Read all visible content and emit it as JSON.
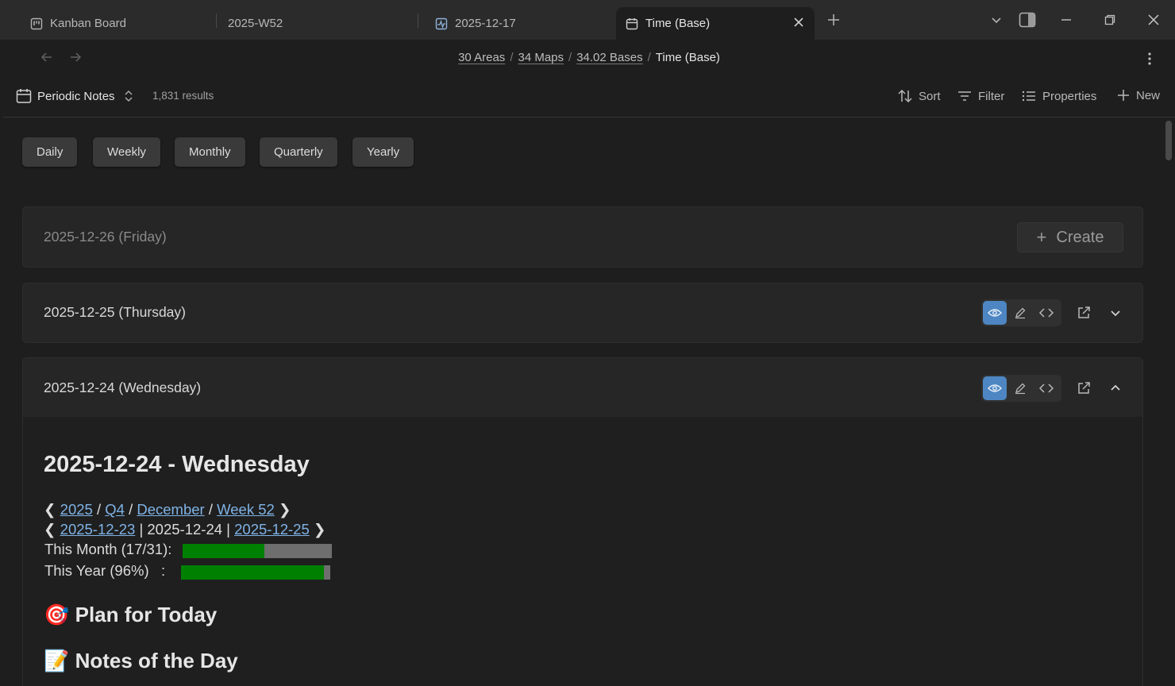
{
  "tabs": [
    {
      "label": "Kanban Board",
      "icon": "kanban-icon"
    },
    {
      "label": "2025-W52",
      "icon": ""
    },
    {
      "label": "2025-12-17",
      "icon": "activity-icon"
    },
    {
      "label": "Time (Base)",
      "icon": "calendar-icon",
      "active": true
    }
  ],
  "breadcrumb": {
    "items": [
      "30 Areas",
      "34 Maps",
      "34.02 Bases"
    ],
    "current": "Time (Base)",
    "separator": "/"
  },
  "base": {
    "view_name": "Periodic Notes",
    "results": "1,831 results",
    "sort": "Sort",
    "filter": "Filter",
    "properties": "Properties",
    "new": "New"
  },
  "filters": [
    "Daily",
    "Weekly",
    "Monthly",
    "Quarterly",
    "Yearly"
  ],
  "cards": [
    {
      "title": "2025-12-26 (Friday)",
      "create_label": "Create"
    },
    {
      "title": "2025-12-25 (Thursday)"
    },
    {
      "title": "2025-12-24 (Wednesday)"
    }
  ],
  "note": {
    "heading": "2025-12-24 - Wednesday",
    "nav1": {
      "prev": "❮",
      "year": "2025",
      "quarter": "Q4",
      "month": "December",
      "week": "Week 52",
      "next": "❯",
      "sep": "/"
    },
    "nav2": {
      "prev": "❮",
      "prev_day": "2025-12-23",
      "today": "2025-12-24",
      "next_day": "2025-12-25",
      "next": "❯",
      "sep": "|"
    },
    "month_label": "This Month (17/31):",
    "month_progress": 0.55,
    "year_label": "This Year (96%)   :",
    "year_progress": 0.96,
    "plan_heading": "🎯 Plan for Today",
    "notes_heading": "📝 Notes of the Day"
  },
  "colors": {
    "accent": "#4d86c2",
    "link": "#7fb3e6",
    "progress_fill": "#008000"
  }
}
